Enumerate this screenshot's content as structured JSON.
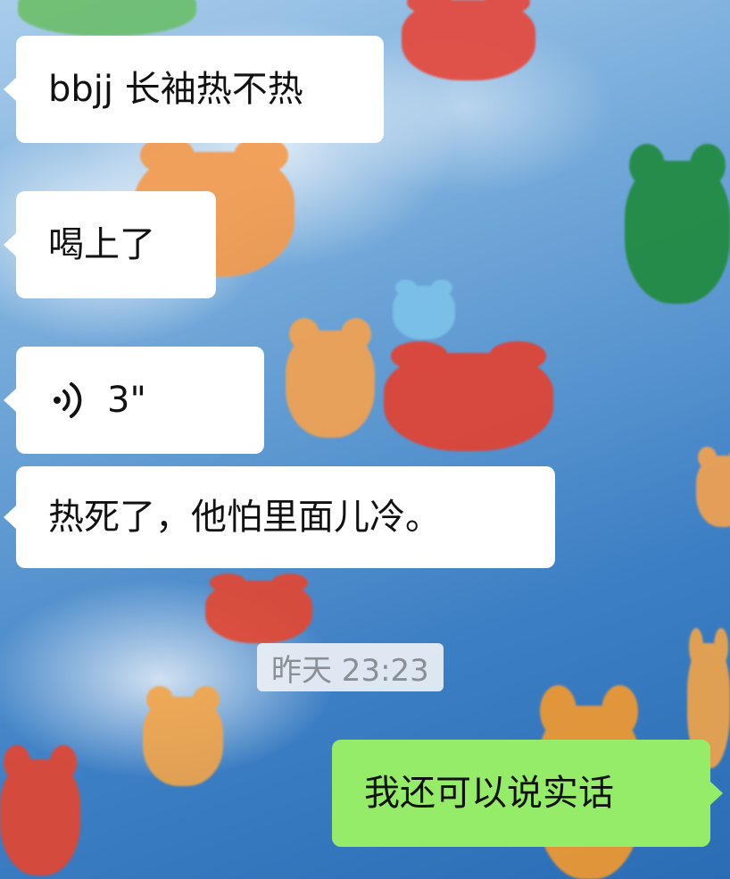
{
  "chat": {
    "messages": [
      {
        "side": "left",
        "type": "text",
        "text": "bbjj 长袖热不热"
      },
      {
        "side": "left",
        "type": "text",
        "text": "喝上了"
      },
      {
        "side": "left",
        "type": "voice",
        "duration": "3\""
      },
      {
        "side": "left",
        "type": "text",
        "text": "热死了，他怕里面儿冷。"
      },
      {
        "side": "right",
        "type": "text",
        "text": "我还可以说实话"
      }
    ],
    "timestamp": "昨天 23:23"
  },
  "colors": {
    "incoming_bubble": "#ffffff",
    "outgoing_bubble": "#95ec69",
    "timestamp_text": "#8a8f95"
  },
  "icons": {
    "voice": "voice-wave-icon"
  }
}
